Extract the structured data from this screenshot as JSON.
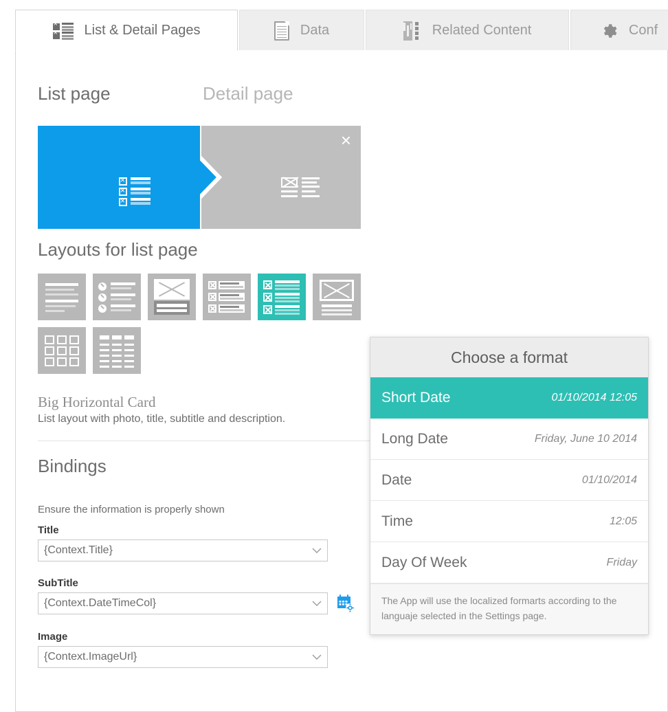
{
  "tabs": [
    {
      "label": "List & Detail Pages",
      "icon": "list-detail-icon",
      "active": true
    },
    {
      "label": "Data",
      "icon": "document-icon",
      "active": false
    },
    {
      "label": "Related Content",
      "icon": "related-content-icon",
      "active": false
    },
    {
      "label": "Conf",
      "icon": "gear-icon",
      "active": false
    }
  ],
  "flow": {
    "list_header": "List page",
    "detail_header": "Detail page",
    "close_glyph": "×"
  },
  "layouts": {
    "header": "Layouts for list page",
    "thumbs": [
      {
        "name": "text-lines-layout",
        "selected": false
      },
      {
        "name": "bullet-list-layout",
        "selected": false
      },
      {
        "name": "photo-caption-layout",
        "selected": false
      },
      {
        "name": "small-horizontal-card-layout",
        "selected": false
      },
      {
        "name": "big-horizontal-card-layout",
        "selected": true
      },
      {
        "name": "big-photo-card-layout",
        "selected": false
      },
      {
        "name": "photo-grid-layout",
        "selected": false
      },
      {
        "name": "table-grid-layout",
        "selected": false
      }
    ],
    "selected_name": "Big Horizontal Card",
    "selected_description": "List layout with photo, title, subtitle and description."
  },
  "bindings": {
    "header": "Bindings",
    "subtitle": "Ensure the information is properly shown",
    "fields": [
      {
        "label": "Title",
        "value": "{Context.Title}",
        "has_format_button": false
      },
      {
        "label": "SubTitle",
        "value": "{Context.DateTimeCol}",
        "has_format_button": true
      },
      {
        "label": "Image",
        "value": "{Context.ImageUrl}",
        "has_format_button": false
      }
    ]
  },
  "format_popup": {
    "title": "Choose a format",
    "options": [
      {
        "name": "Short Date",
        "sample": "01/10/2014 12:05",
        "selected": true
      },
      {
        "name": "Long Date",
        "sample": "Friday, June 10 2014",
        "selected": false
      },
      {
        "name": "Date",
        "sample": "01/10/2014",
        "selected": false
      },
      {
        "name": "Time",
        "sample": "12:05",
        "selected": false
      },
      {
        "name": "Day Of Week",
        "sample": "Friday",
        "selected": false
      }
    ],
    "note": "The App will use the localized formarts according to the languaje selected in the Settings page."
  },
  "colors": {
    "accent_teal": "#2EBFB4",
    "accent_blue": "#0D9CE9",
    "tile_gray": "#BFBFBF",
    "thumb_gray": "#B8B8B8"
  }
}
